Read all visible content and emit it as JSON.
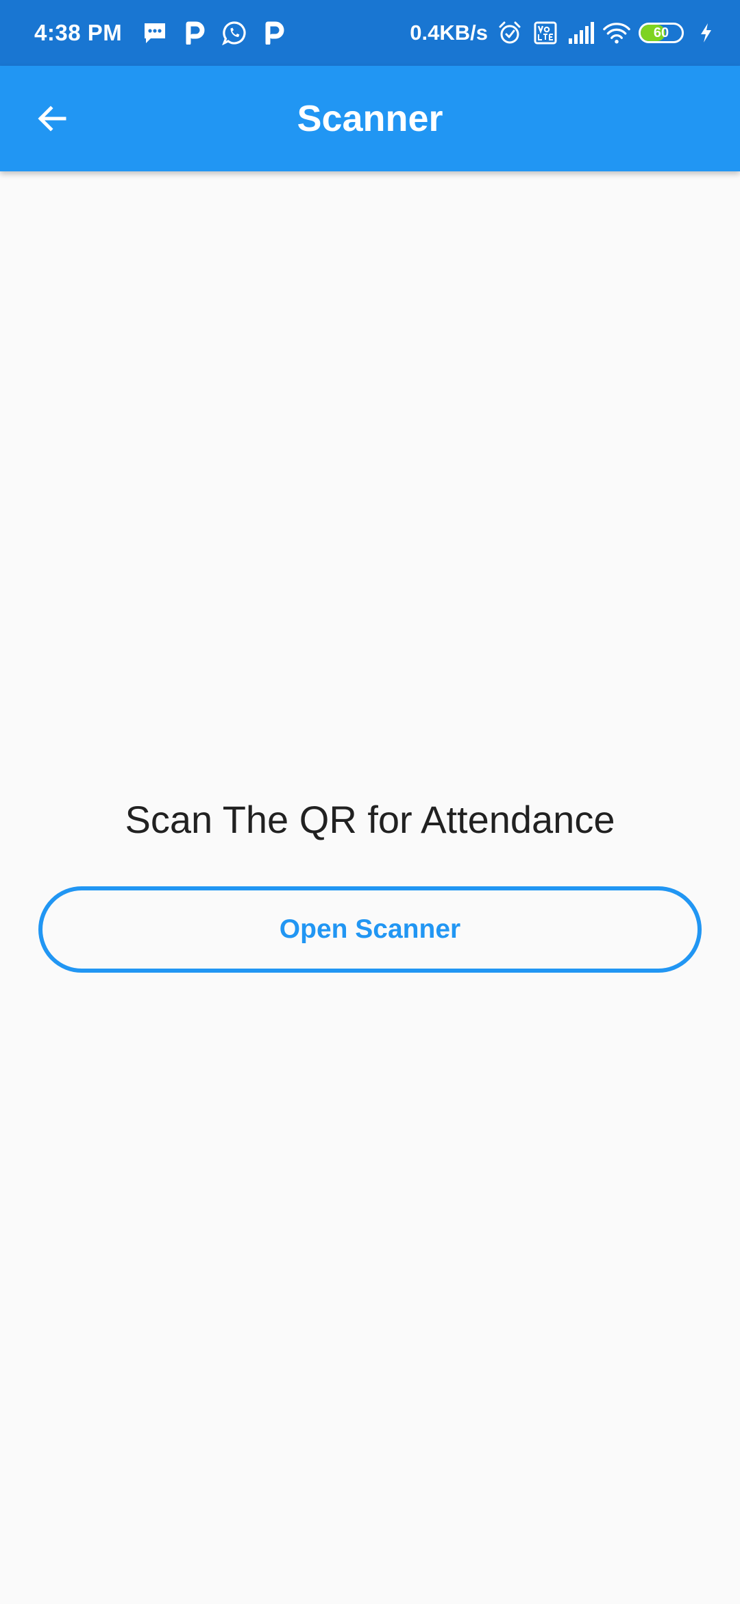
{
  "status_bar": {
    "time": "4:38 PM",
    "notification_icons": [
      "message-icon",
      "p-app-icon",
      "whatsapp-icon",
      "p-app-icon"
    ],
    "network_speed": "0.4KB/s",
    "system_icons": [
      "alarm-icon",
      "volte-icon",
      "signal-icon",
      "wifi-icon"
    ],
    "battery_level": "60",
    "battery_fill_fraction": 0.6,
    "charging": true
  },
  "app_bar": {
    "title": "Scanner",
    "back_icon": "arrow-back-icon"
  },
  "main": {
    "prompt": "Scan The QR for Attendance",
    "button_label": "Open Scanner"
  },
  "colors": {
    "status_bar": "#1976d2",
    "app_bar": "#2196f3",
    "accent": "#2196f3",
    "background": "#fafafa",
    "text": "#212121",
    "battery": "#7ed321"
  }
}
